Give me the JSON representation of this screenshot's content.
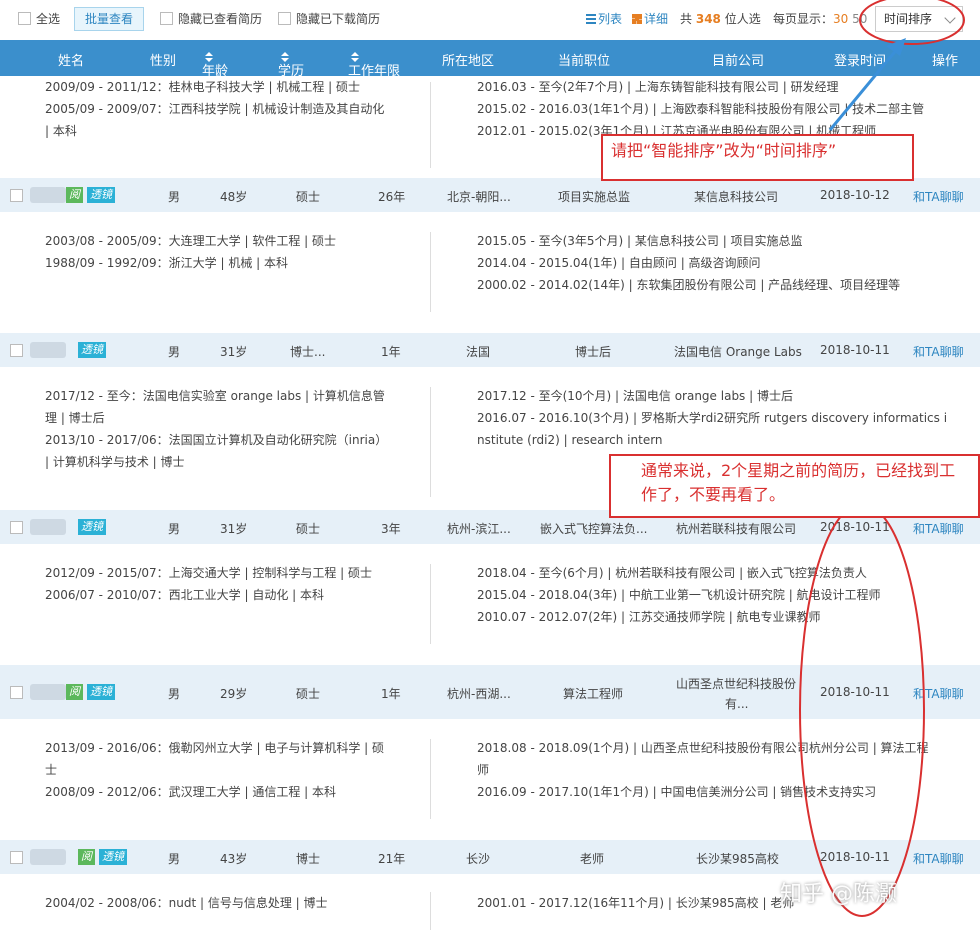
{
  "toolbar": {
    "select_all": "全选",
    "batch_view": "批量查看",
    "hide_viewed": "隐藏已查看简历",
    "hide_downloaded": "隐藏已下载简历",
    "list_view": "列表",
    "detail_view": "详细",
    "total_prefix": "共",
    "total_count": "348",
    "total_suffix": "位人选",
    "per_page_label": "每页显示：",
    "per_page_30": "30",
    "per_page_50": "50",
    "sort_value": "时间排序"
  },
  "header": {
    "name": "姓名",
    "gender": "性别",
    "age": "年龄",
    "education": "学历",
    "work_years": "工作年限",
    "location": "所在地区",
    "current_position": "当前职位",
    "target_company": "目前公司",
    "login_time": "登录时间",
    "action": "操作"
  },
  "details": [
    {
      "edu": [
        "2009/09 - 2011/12：桂林电子科技大学 | 机械工程 | 硕士",
        "2005/09 - 2009/07：江西科技学院 | 机械设计制造及其自动化",
        "| 本科"
      ],
      "work": [
        "2016.03 - 至今(2年7个月) | 上海东铸智能科技有限公司 | 研发经理",
        "2015.02 - 2016.03(1年1个月) | 上海欧泰科智能科技股份有限公司 | 技术二部主管",
        "2012.01 - 2015.02(3年1个月) | 江苏京通光电股份有限公司 | 机械工程师"
      ]
    },
    {
      "edu": [
        "2003/08 - 2005/09：大连理工大学 | 软件工程 | 硕士",
        "1988/09 - 1992/09：浙江大学 | 机械 | 本科"
      ],
      "work": [
        "2015.05 - 至今(3年5个月) | 某信息科技公司 | 项目实施总监",
        "2014.04 - 2015.04(1年) | 自由顾问 | 高级咨询顾问",
        "2000.02 - 2014.02(14年) | 东软集团股份有限公司 | 产品线经理、项目经理等"
      ]
    },
    {
      "edu": [
        "2017/12 - 至今：法国电信实验室 orange labs | 计算机信息管",
        "理 | 博士后",
        "2013/10 - 2017/06：法国国立计算机及自动化研究院（inria）",
        "| 计算机科学与技术 | 博士"
      ],
      "work": [
        "2017.12 - 至今(10个月) | 法国电信 orange labs | 博士后",
        "2016.07 - 2016.10(3个月) | 罗格斯大学rdi2研究所 rutgers discovery informatics i",
        "nstitute (rdi2) | research intern"
      ]
    },
    {
      "edu": [
        "2012/09 - 2015/07：上海交通大学 | 控制科学与工程 | 硕士",
        "2006/07 - 2010/07：西北工业大学 | 自动化 | 本科"
      ],
      "work": [
        "2018.04 - 至今(6个月) | 杭州若联科技有限公司 | 嵌入式飞控算法负责人",
        "2015.04 - 2018.04(3年) | 中航工业第一飞机设计研究院 | 航电设计工程师",
        "2010.07 - 2012.07(2年) | 江苏交通技师学院 | 航电专业课教师"
      ]
    },
    {
      "edu": [
        "2013/09 - 2016/06：俄勒冈州立大学 | 电子与计算机科学 | 硕",
        "士",
        "2008/09 - 2012/06：武汉理工大学 | 通信工程 | 本科"
      ],
      "work": [
        "2018.08 - 2018.09(1个月) | 山西圣点世纪科技股份有限公司杭州分公司 | 算法工程",
        "师",
        "2016.09 - 2017.10(1年1个月) | 中国电信美洲分公司 | 销售技术支持实习"
      ]
    },
    {
      "edu": [
        "2004/02 - 2008/06：nudt | 信号与信息处理 | 博士"
      ],
      "work": [
        "2001.01 - 2017.12(16年11个月) | 长沙某985高校 | 老师"
      ]
    }
  ],
  "rows": [
    {
      "gender": "男",
      "age": "48岁",
      "edu": "硕士",
      "years": "26年",
      "location": "北京-朝阳...",
      "position": "项目实施总监",
      "company": "某信息科技公司",
      "company2": "",
      "date": "2018-10-12",
      "action": "和TA聊聊",
      "read": "阅",
      "lens": "透镜"
    },
    {
      "gender": "男",
      "age": "31岁",
      "edu": "博士...",
      "years": "1年",
      "location": "法国",
      "position": "博士后",
      "company": "法国电信 Orange Labs",
      "company2": "",
      "date": "2018-10-11",
      "action": "和TA聊聊",
      "read": "",
      "lens": "透镜"
    },
    {
      "gender": "男",
      "age": "31岁",
      "edu": "硕士",
      "years": "3年",
      "location": "杭州-滨江...",
      "position": "嵌入式飞控算法负...",
      "company": "杭州若联科技有限公司",
      "company2": "",
      "date": "2018-10-11",
      "action": "和TA聊聊",
      "read": "",
      "lens": "透镜"
    },
    {
      "gender": "男",
      "age": "29岁",
      "edu": "硕士",
      "years": "1年",
      "location": "杭州-西湖...",
      "position": "算法工程师",
      "company": "山西圣点世纪科技股份",
      "company2": "有...",
      "date": "2018-10-11",
      "action": "和TA聊聊",
      "read": "阅",
      "lens": "透镜"
    },
    {
      "gender": "男",
      "age": "43岁",
      "edu": "博士",
      "years": "21年",
      "location": "长沙",
      "position": "老师",
      "company": "长沙某985高校",
      "company2": "",
      "date": "2018-10-11",
      "action": "和TA聊聊",
      "read": "阅",
      "lens": "透镜"
    }
  ],
  "annotations": {
    "sort_note": "请把“智能排序”改为“时间排序”",
    "old_note": "通常来说，2个星期之前的简历，已经找到工作了，不要再看了。"
  },
  "watermark": "知乎 @陈灏",
  "colors": {
    "header": "#3b8fcc",
    "row": "#e6f0f8",
    "annotation": "#d93030",
    "accent": "#e67e22",
    "link": "#2e86c1"
  }
}
